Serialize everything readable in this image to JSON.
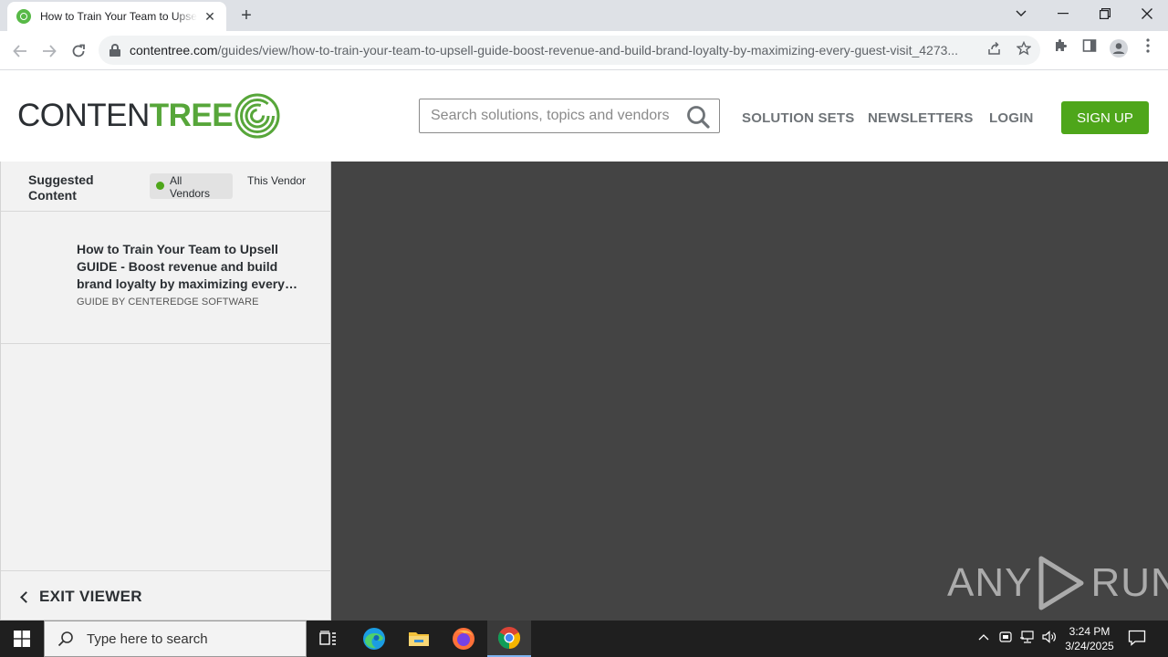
{
  "browser": {
    "tab_title": "How to Train Your Team to Upsell GUIDE - Boost revenue",
    "tab_close": "✕",
    "new_tab": "+",
    "url_domain": "contentree.com",
    "url_path": "/guides/view/how-to-train-your-team-to-upsell-guide-boost-revenue-and-build-brand-loyalty-by-maximizing-every-guest-visit_4273..."
  },
  "site": {
    "logo_part1": "CONTEN",
    "logo_part2": "TREE",
    "search_placeholder": "Search solutions, topics and vendors",
    "nav": {
      "solution_sets": "SOLUTION SETS",
      "newsletters": "NEWSLETTERS",
      "login": "LOGIN",
      "signup": "SIGN UP"
    },
    "brand_color": "#4ea61a"
  },
  "sidebar": {
    "title": "Suggested Content",
    "filter_all": "All Vendors",
    "filter_this": "This Vendor",
    "items": [
      {
        "title": "How to Train Your Team to Upsell GUIDE - Boost revenue and build brand loyalty by maximizing every guest visit",
        "meta": "GUIDE BY CENTEREDGE SOFTWARE"
      }
    ],
    "exit_label": "EXIT VIEWER"
  },
  "watermark": {
    "left": "ANY",
    "right": "RUN"
  },
  "taskbar": {
    "search_text": "Type here to search",
    "time": "3:24 PM",
    "date": "3/24/2025"
  }
}
